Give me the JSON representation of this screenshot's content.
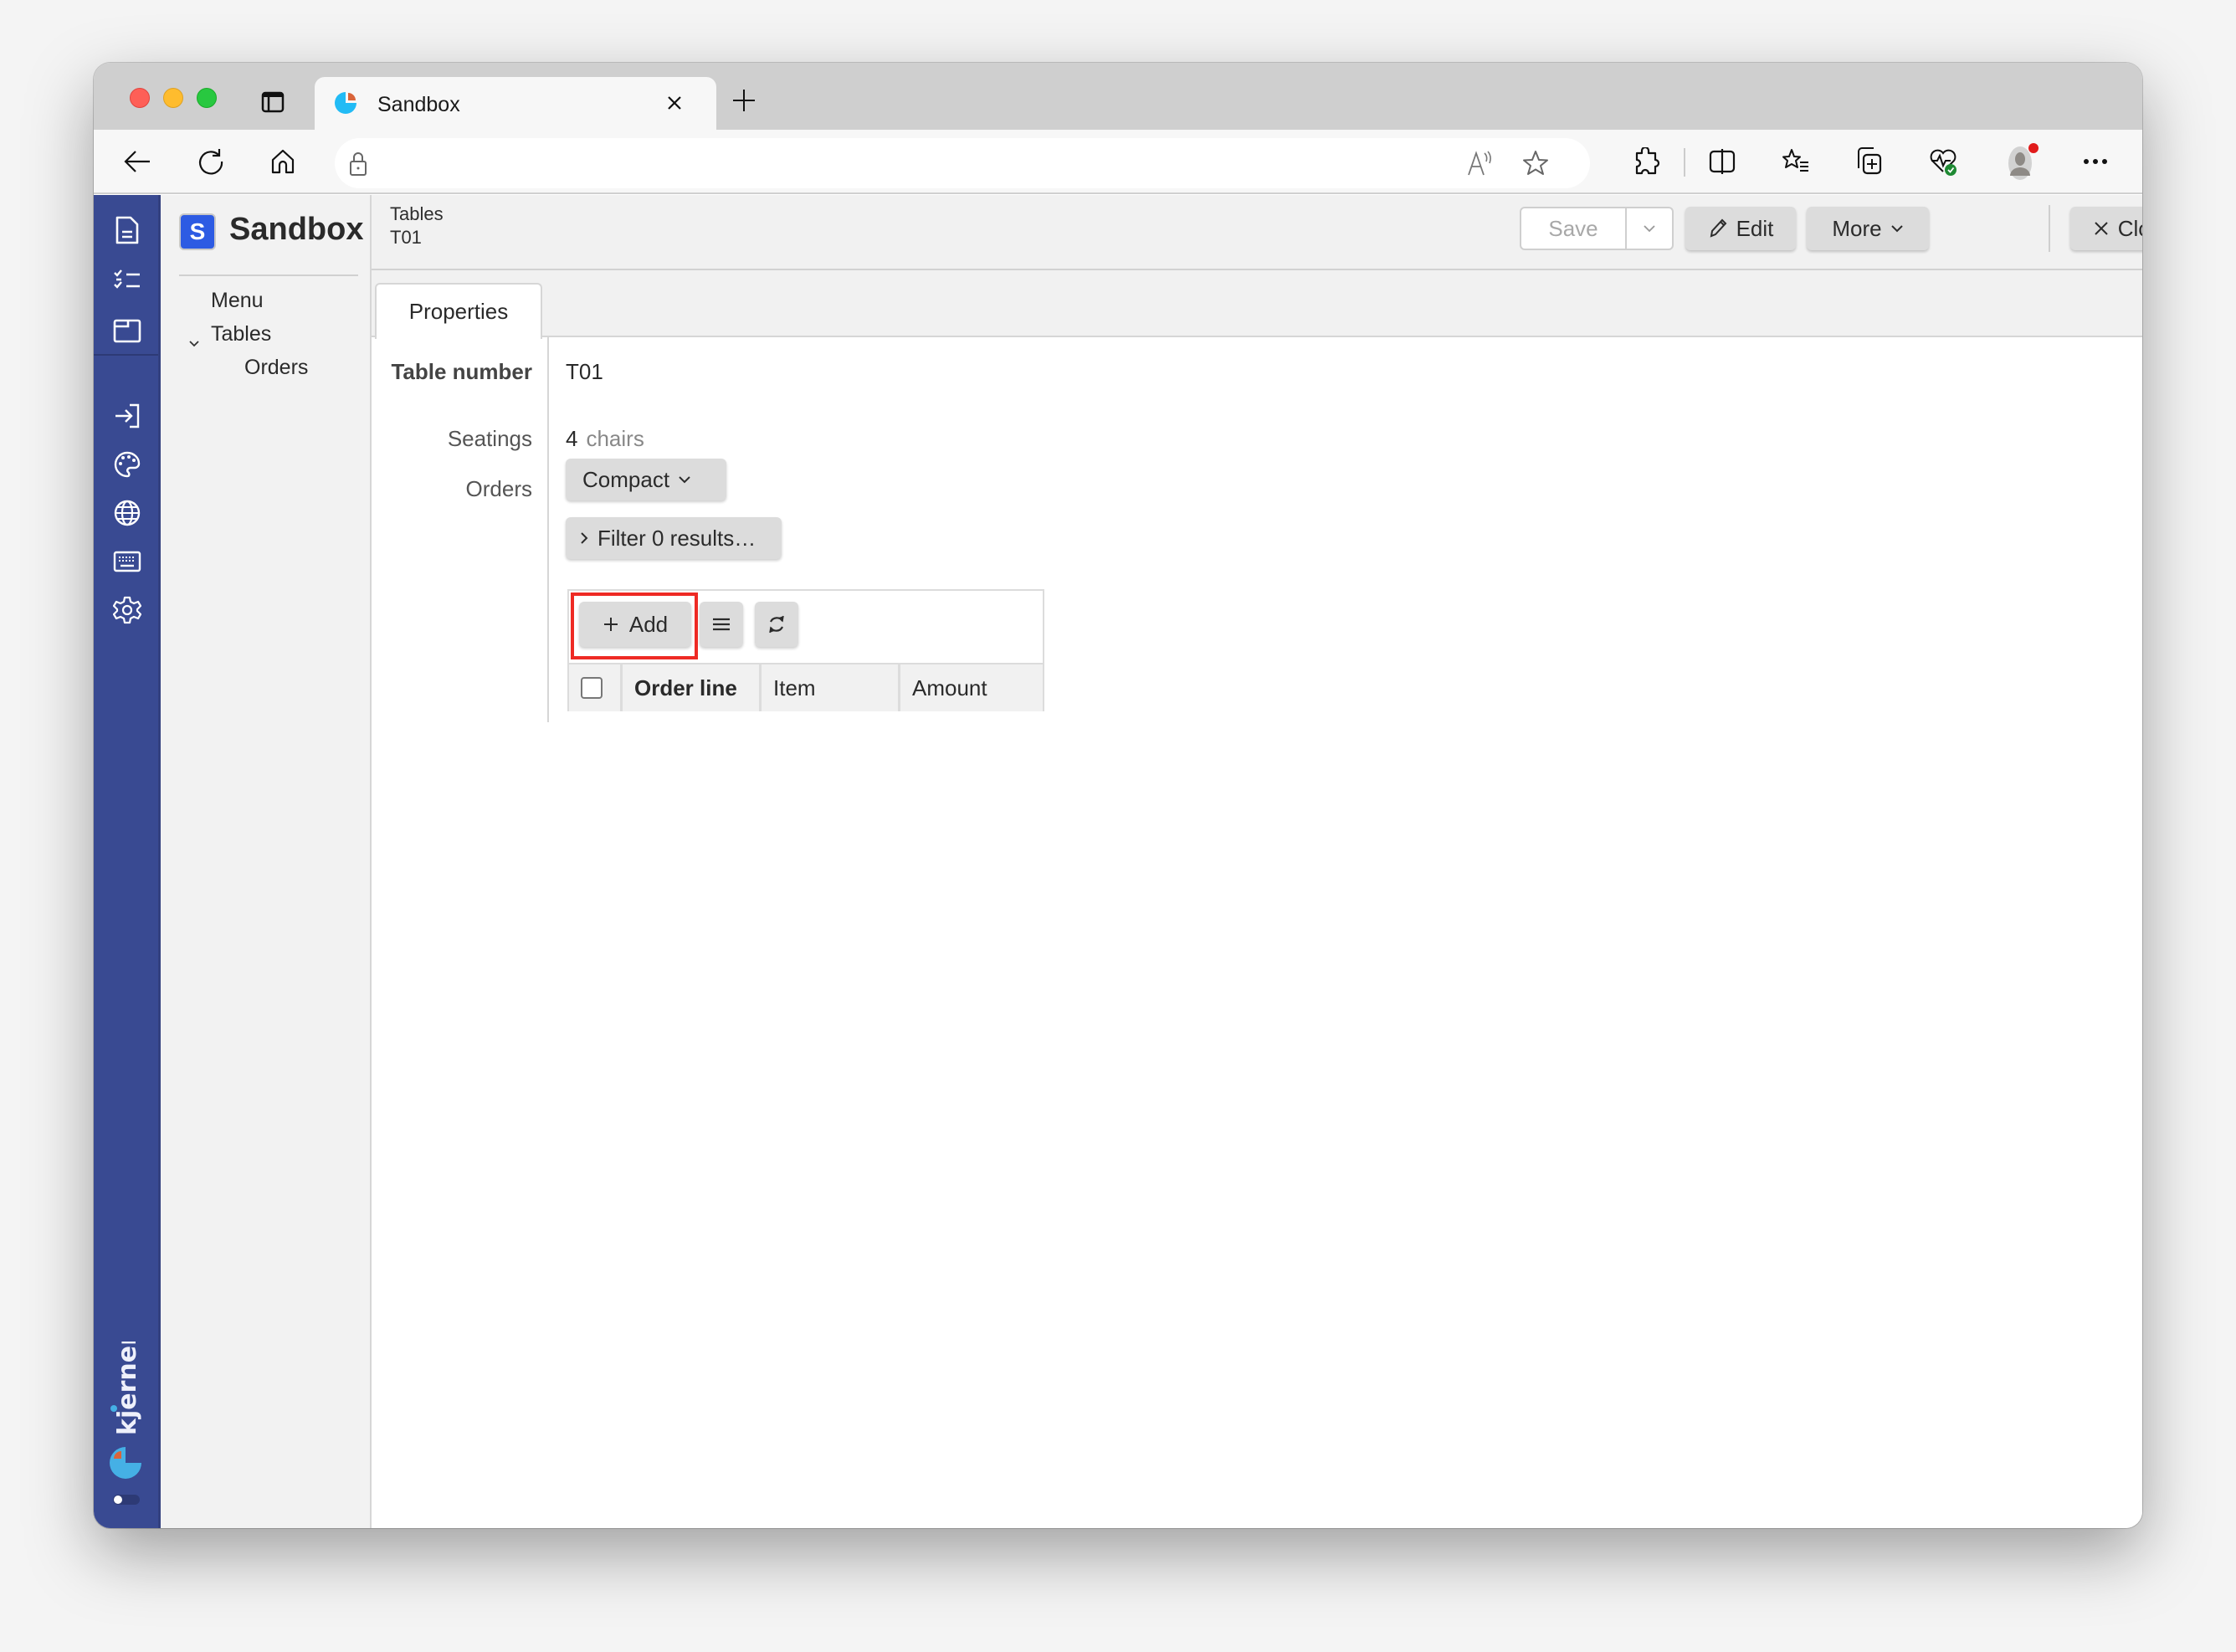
{
  "browser": {
    "tab_title": "Sandbox",
    "url": "",
    "icons": {
      "tab_actions": "tab-actions-icon",
      "new_tab": "plus-icon",
      "back": "back-arrow-icon",
      "refresh": "refresh-icon",
      "home": "home-icon",
      "lock": "lock-icon",
      "read_aloud": "read-aloud-icon",
      "favorite": "star-icon",
      "extensions": "puzzle-icon",
      "split_screen": "split-screen-icon",
      "favorites": "favorites-list-icon",
      "collections": "collections-icon",
      "performance": "heartbeat-icon",
      "profile": "profile-avatar",
      "more": "ellipsis-icon"
    }
  },
  "rail": {
    "top_icons": [
      "document-icon",
      "checklist-icon",
      "window-icon"
    ],
    "bottom_icons": [
      "sign-in-icon",
      "palette-icon",
      "globe-icon",
      "keyboard-icon",
      "gear-icon"
    ],
    "brand": "kjerner"
  },
  "app": {
    "logo_letter": "S",
    "name": "Sandbox"
  },
  "nav": {
    "items": [
      {
        "label": "Menu",
        "level": 0
      },
      {
        "label": "Tables",
        "level": 0,
        "expanded": true
      },
      {
        "label": "Orders",
        "level": 1
      }
    ]
  },
  "header": {
    "breadcrumb": [
      "Tables",
      "T01"
    ],
    "buttons": {
      "save": "Save",
      "edit": "Edit",
      "more": "More",
      "close": "Close"
    }
  },
  "tabs": [
    {
      "label": "Properties",
      "active": true
    }
  ],
  "form": {
    "fields": [
      {
        "label": "Table number",
        "value": "T01"
      },
      {
        "label": "Seatings",
        "value": "4",
        "unit": "chairs"
      },
      {
        "label": "Orders"
      }
    ],
    "orders": {
      "view_mode": "Compact",
      "filter_label": "Filter 0 results…",
      "add_label": "Add",
      "columns": [
        "Order line",
        "Item",
        "Amount"
      ],
      "rows": []
    }
  },
  "colors": {
    "rail": "#394a92",
    "logo": "#2d5be3",
    "highlight": "#ee2a24"
  }
}
